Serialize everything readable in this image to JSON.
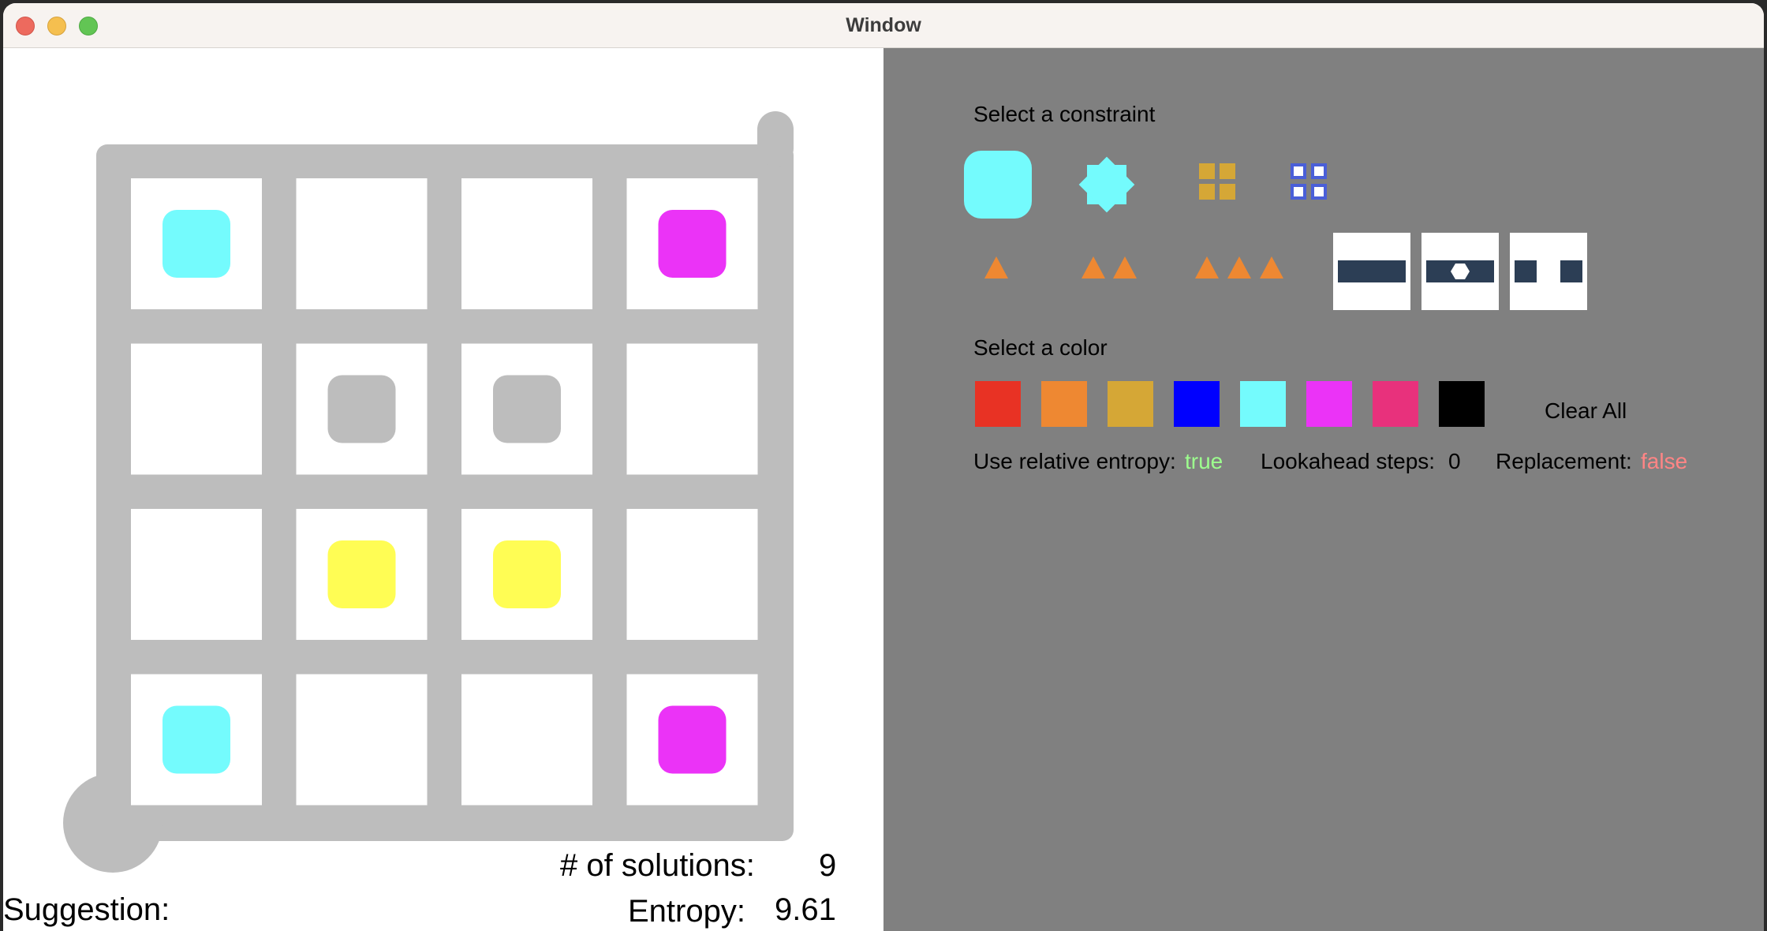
{
  "window": {
    "title": "Window"
  },
  "board": {
    "rows": 4,
    "cols": 4,
    "cells": [
      [
        "cyan",
        null,
        null,
        "magenta"
      ],
      [
        null,
        "gray",
        "gray",
        null
      ],
      [
        null,
        "yellow",
        "yellow",
        null
      ],
      [
        "cyan",
        null,
        null,
        "magenta"
      ]
    ]
  },
  "stats": {
    "solutions_label": "# of solutions:",
    "solutions_value": "9",
    "entropy_label": "Entropy:",
    "entropy_value": "9.61",
    "suggestion_label": "Suggestion:"
  },
  "panel": {
    "constraint_label": "Select a constraint",
    "color_label": "Select a color",
    "clear_all": "Clear All",
    "relative_entropy_label": "Use relative entropy:",
    "relative_entropy_value": "true",
    "lookahead_label": "Lookahead steps:",
    "lookahead_value": "0",
    "replacement_label": "Replacement:",
    "replacement_value": "false"
  },
  "constraints": [
    "square-constraint-icon",
    "star-constraint-icon",
    "filled-tetris-constraint-icon",
    "hollow-tetris-constraint-icon",
    "one-triangle-constraint-icon",
    "two-triangles-constraint-icon",
    "three-triangles-constraint-icon",
    "broken-line-constraint-icon",
    "hexagon-dot-constraint-icon",
    "gap-line-constraint-icon"
  ],
  "colors": {
    "palette": [
      "#e83224",
      "#ee8832",
      "#d5a736",
      "#0000ff",
      "#74fbfd",
      "#eb33f7",
      "#e8317c",
      "#000000"
    ],
    "cyan": "#74fbfd",
    "magenta": "#eb33f7",
    "gray": "#bdbdbd",
    "yellow": "#fffd54",
    "grid": "#bdbdbd",
    "panel_bg": "#808080"
  }
}
